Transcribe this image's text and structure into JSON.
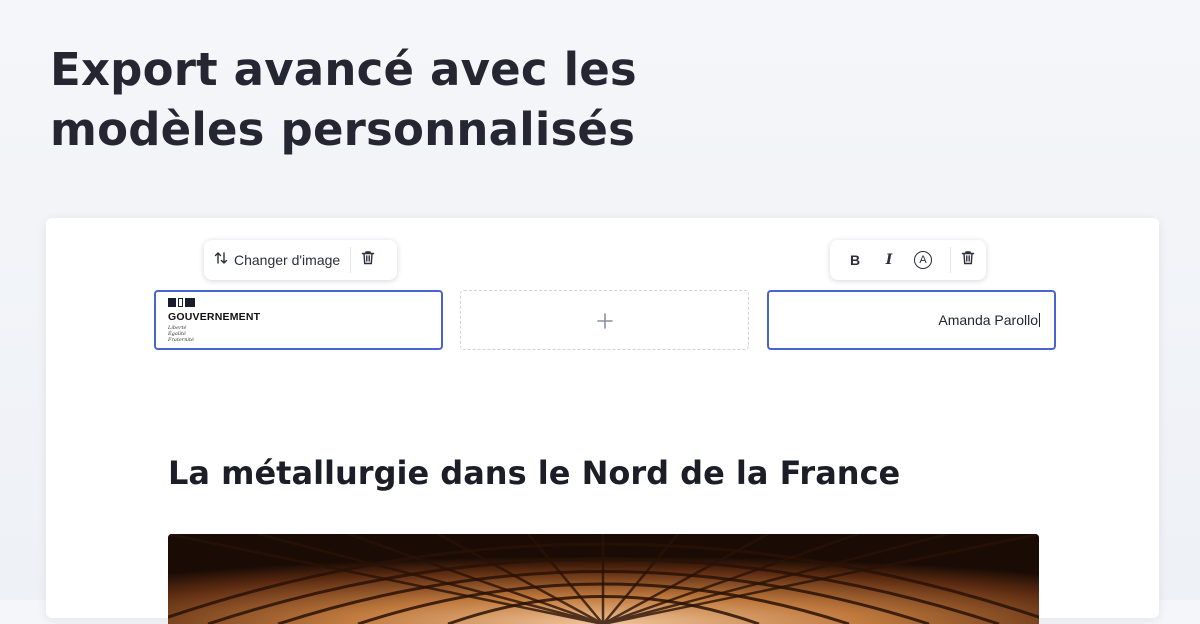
{
  "headline": {
    "line1": "Export avancé avec les",
    "line2": "modèles personnalisés"
  },
  "image_toolbar": {
    "change_label": "Changer d'image",
    "change_icon": "swap-vertical-icon",
    "delete_icon": "trash-icon"
  },
  "text_toolbar": {
    "bold_label": "B",
    "italic_label": "I",
    "color_label": "A",
    "delete_icon": "trash-icon"
  },
  "header_slots": {
    "left_logo": {
      "name": "GOUVERNEMENT",
      "motto": [
        "Liberté",
        "Égalité",
        "Fraternité"
      ]
    },
    "middle_add_icon": "plus-icon",
    "right_text": "Amanda Parollo"
  },
  "document": {
    "title": "La métallurgie dans le Nord de la France",
    "hero_image": "metal-vault-structure"
  },
  "colors": {
    "selection_border": "#4a63d4",
    "headline_text": "#242731",
    "hero_copper": "#b8652a"
  }
}
